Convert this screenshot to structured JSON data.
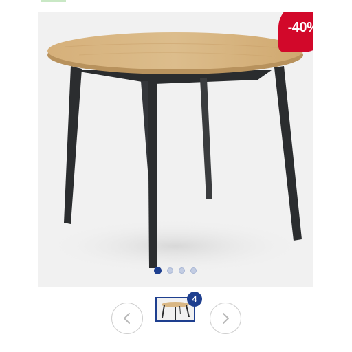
{
  "product": {
    "image_alt_icon": "round-dining-table-image",
    "discount_badge": "-40%"
  },
  "gallery": {
    "active_index": 1,
    "total_images": 4,
    "thumbnail_count": "4",
    "prev_icon": "chevron-left-icon",
    "next_icon": "chevron-right-icon"
  },
  "colors": {
    "badge": "#d2082a",
    "accent": "#1e3f8f",
    "tabletop": "#d9b784",
    "legs": "#2b2d2f"
  }
}
